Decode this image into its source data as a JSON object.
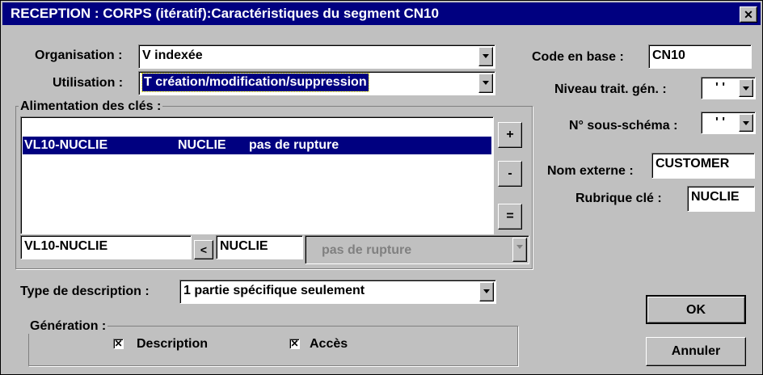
{
  "window": {
    "title": "RECEPTION : CORPS (itératif):Caractéristiques du segment CN10",
    "close_glyph": "✕"
  },
  "organisation": {
    "label": "Organisation :",
    "value": "V indexée"
  },
  "utilisation": {
    "label": "Utilisation :",
    "value": "T création/modification/suppression"
  },
  "code_en_base": {
    "label": "Code en base :",
    "value": "CN10"
  },
  "niveau": {
    "label": "Niveau trait. gén. :",
    "value": "' '"
  },
  "sous_schema": {
    "label": "N° sous-schéma :",
    "value": "' '"
  },
  "nom_externe": {
    "label": "Nom externe :",
    "value": "CUSTOMER"
  },
  "rubrique_cle": {
    "label": "Rubrique clé :",
    "value": "NUCLIE"
  },
  "alimentation": {
    "label": "Alimentation des clés :",
    "rows": [
      {
        "key": "VL10-NUCLIE",
        "field": "NUCLIE",
        "rupture": "pas de rupture",
        "selected": true
      }
    ],
    "btn_add": "+",
    "btn_remove": "-",
    "btn_equal": "=",
    "edit_key": "VL10-NUCLIE",
    "arrow": "<",
    "edit_field": "NUCLIE",
    "edit_rupture": "pas de rupture"
  },
  "type_description": {
    "label": "Type de description :",
    "value": "1 partie spécifique seulement"
  },
  "generation": {
    "label": "Génération :",
    "description": {
      "label": "Description",
      "checked": true
    },
    "acces": {
      "label": "Accès",
      "checked": true
    },
    "check_glyph": "✕"
  },
  "buttons": {
    "ok": "OK",
    "cancel": "Annuler"
  }
}
